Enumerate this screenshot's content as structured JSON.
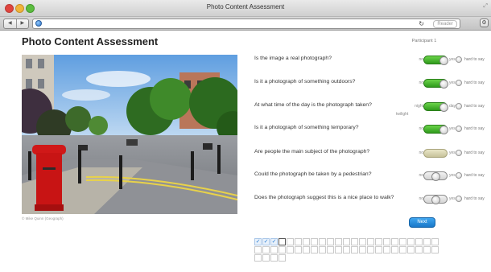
{
  "window": {
    "title": "Photo Content Assessment"
  },
  "toolbar": {
    "reader_label": "Reader"
  },
  "page": {
    "title": "Photo Content Assessment",
    "participant_label": "Participant 1",
    "photo_credit": "© Mike Quinn (Geograph)"
  },
  "questions": [
    {
      "text": "Is the image a real photograph?",
      "left": "no",
      "right": "yes",
      "state": "yes",
      "alt": "hard to say"
    },
    {
      "text": "Is it a photograph of something outdoors?",
      "left": "no",
      "right": "yes",
      "state": "yes",
      "alt": "hard to say"
    },
    {
      "text": "At what time of the day is the photograph taken?",
      "left": "night",
      "right": "day",
      "under": "twilight",
      "state": "day",
      "alt": "hard to say"
    },
    {
      "text": "Is it a photograph of something temporary?",
      "left": "no",
      "right": "yes",
      "state": "yes",
      "alt": "hard to say"
    },
    {
      "text": "Are people the main subject of the photograph?",
      "left": "no",
      "right": "yes",
      "state": "unset",
      "alt": "hard to say"
    },
    {
      "text": "Could the photograph be taken by a pedestrian?",
      "left": "no",
      "right": "yes",
      "state": "unset-mid",
      "alt": "hard to say"
    },
    {
      "text": "Does the photograph suggest this is a nice place to walk?",
      "left": "no",
      "right": "yes",
      "state": "unset-mid",
      "alt": "hard to say"
    }
  ],
  "next_button": {
    "label": "Next"
  },
  "progress": {
    "total": 50,
    "completed": 3,
    "current": 4,
    "check_glyph": "✓"
  },
  "colors": {
    "toggle_on": "#3fae2a",
    "next_button": "#2a8ee0"
  }
}
